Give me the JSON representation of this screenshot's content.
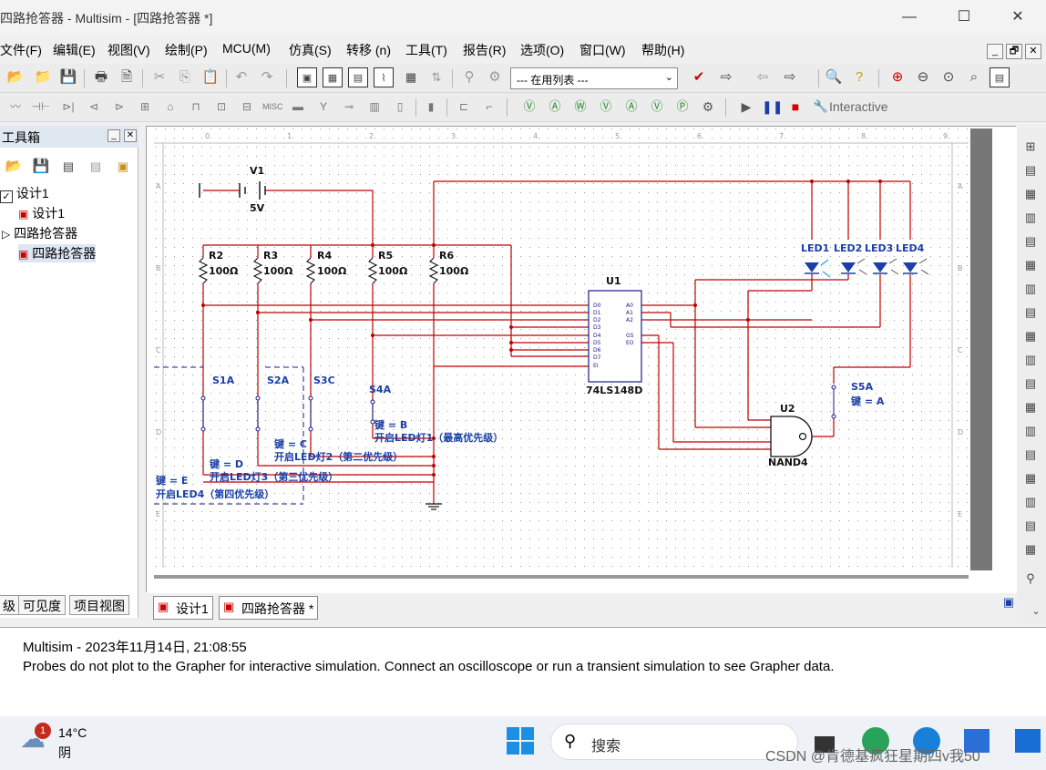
{
  "window": {
    "title": "四路抢答器 - Multisim - [四路抢答器 *]",
    "min": "—",
    "max": "☐",
    "close": "✕"
  },
  "menu": [
    "文件(F)",
    "编辑(E)",
    "视图(V)",
    "绘制(P)",
    "MCU(M)",
    "仿真(S)",
    "转移 (n)",
    "工具(T)",
    "报告(R)",
    "选项(O)",
    "窗口(W)",
    "帮助(H)"
  ],
  "mdi": [
    "_",
    "🗗",
    "✕"
  ],
  "toolbar": {
    "combo_value": "--- 在用列表 ---",
    "interactive_label": "Interactive"
  },
  "toolbox": {
    "title": "工具箱",
    "tree": [
      {
        "label": "设计1",
        "level": 0
      },
      {
        "label": "设计1",
        "level": 1
      },
      {
        "label": "四路抢答器",
        "level": 0
      },
      {
        "label": "四路抢答器",
        "level": 1
      }
    ],
    "tabs": [
      "级",
      "可见度",
      "项目视图"
    ]
  },
  "doc_tabs": [
    "设计1",
    "四路抢答器 *"
  ],
  "schematic": {
    "v1": "V1",
    "v1_val": "5V",
    "resistors": [
      {
        "name": "R2",
        "value": "100Ω"
      },
      {
        "name": "R3",
        "value": "100Ω"
      },
      {
        "name": "R4",
        "value": "100Ω"
      },
      {
        "name": "R5",
        "value": "100Ω"
      },
      {
        "name": "R6",
        "value": "100Ω"
      }
    ],
    "leds": [
      "LED1",
      "LED2",
      "LED3",
      "LED4"
    ],
    "u1": "U1",
    "u1_part": "74LS148D",
    "u2": "U2",
    "u2_part": "NAND4",
    "switches": [
      "S1A",
      "S2A",
      "S3C",
      "S4A",
      "S5A"
    ],
    "notes": {
      "s5": "键 = A",
      "s4_key": "键 = B",
      "s4_desc": "开启LED灯1（最高优先级）",
      "s3_key": "键 = C",
      "s3_desc": "开启LED灯2（第二优先级）",
      "s2_key": "键 = D",
      "s2_desc": "开启LED灯3（第三优先级）",
      "s1_key": "键 = E",
      "s1_desc": "开启LED4（第四优先级）"
    },
    "row_labels": [
      "A",
      "B",
      "C",
      "D",
      "E"
    ],
    "col_labels": [
      "0",
      "1",
      "2",
      "3",
      "4",
      "5",
      "6",
      "7",
      "8",
      "9"
    ]
  },
  "status": {
    "line1": "Multisim  -  2023年11月14日, 21:08:55",
    "line2": "Probes do not plot to the Grapher for interactive simulation. Connect an oscilloscope or run a transient simulation to see Grapher data."
  },
  "taskbar": {
    "weather_temp": "14°C",
    "weather_desc": "阴",
    "badge": "1",
    "search": "搜索",
    "watermark": "CSDN @肯德基疯狂星期四v我50"
  }
}
